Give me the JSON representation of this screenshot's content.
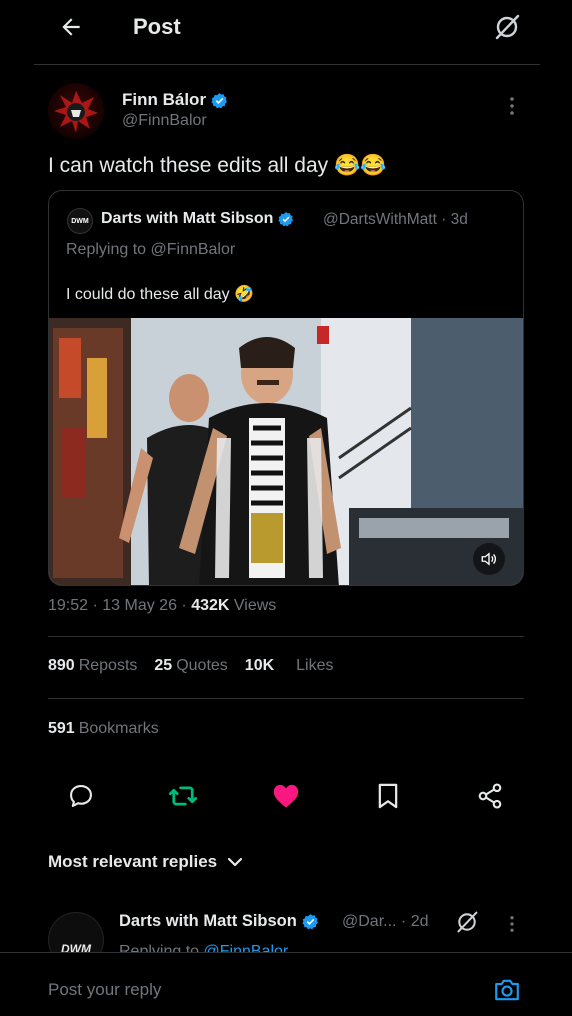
{
  "header": {
    "title": "Post"
  },
  "tweet": {
    "author_name": "Finn Bálor",
    "author_handle": "@FinnBalor",
    "text": "I can watch these edits all day 😂😂"
  },
  "quote": {
    "avatar_text": "DWM",
    "author_name": "Darts with Matt Sibson",
    "handle_time": "@DartsWithMatt · 3d",
    "replying_to": "Replying to @FinnBalor",
    "text": "I could do these all day 🤣"
  },
  "meta": {
    "time_date": "19:52 · 13 May 26 · ",
    "views_count": "432K",
    "views_label": " Views"
  },
  "stats": {
    "reposts_count": "890",
    "reposts_label": "Reposts",
    "quotes_count": "25",
    "quotes_label": "Quotes",
    "likes_count": "10K",
    "likes_label": "Likes",
    "bookmarks_count": "591",
    "bookmarks_label": "Bookmarks"
  },
  "replies_header": "Most relevant replies",
  "reply": {
    "avatar_text": "DWM",
    "author_name": "Darts with Matt Sibson",
    "handle_time": "@Dar... · 2d",
    "replying_prefix": "Replying to ",
    "replying_mention": "@FinnBalor"
  },
  "composer": {
    "placeholder": "Post your reply"
  },
  "colors": {
    "accent": "#1d9bf0",
    "like": "#f91880",
    "repost": "#00ba7c",
    "muted": "#71767b"
  },
  "icons": [
    "back-arrow-icon",
    "grok-icon",
    "more-icon",
    "verified-icon",
    "volume-icon",
    "reply-icon",
    "repost-icon",
    "like-icon",
    "bookmark-icon",
    "share-icon",
    "chevron-down-icon",
    "camera-icon"
  ]
}
